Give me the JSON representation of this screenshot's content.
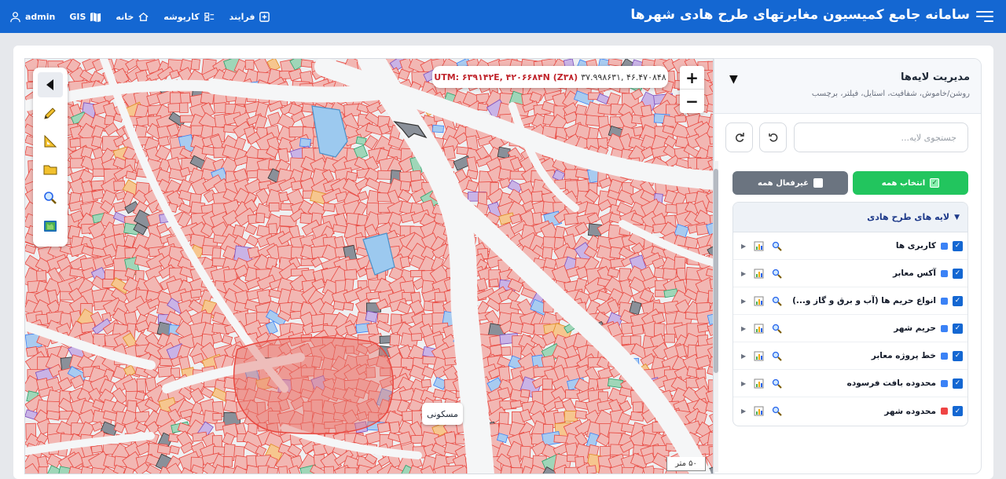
{
  "app": {
    "title": "سامانه جامع کمیسیون مغایرتهای طرح هادی شهرها"
  },
  "nav": {
    "items": [
      {
        "label": "فرایند",
        "icon": "plus-box-icon"
      },
      {
        "label": "کارپوشه",
        "icon": "folder-list-icon"
      },
      {
        "label": "خانه",
        "icon": "home-icon"
      },
      {
        "label": "GIS",
        "icon": "map-icon"
      },
      {
        "label": "admin",
        "icon": "user-icon"
      }
    ]
  },
  "map": {
    "coordinates": {
      "utm": "UTM: ۶۳۹۱۴۲E, ۴۲۰۶۶۸۴N (Z۳۸)",
      "latlng": "۳۷.۹۹۸۶۳۱, ۴۶.۴۷۰۸۴۸"
    },
    "zoom_in": "+",
    "zoom_out": "−",
    "place_label": "مسکونی",
    "scale_text": "۵۰ متر",
    "tools": [
      "pointer-icon",
      "pencil-icon",
      "ruler-triangle-icon",
      "folder-icon",
      "magnifier-icon",
      "book-map-icon"
    ],
    "colors": {
      "parcel_fill": "#f2b7b3",
      "parcel_stroke": "#e8473f",
      "road": "#f5f6f7",
      "background": "#eef0f2"
    }
  },
  "panel": {
    "title": "مدیریت لایه‌ها",
    "subtitle": "روشن/خاموش، شفافیت، استایل، فیلتر، برچسب",
    "search_placeholder": "جستجوی لایه...",
    "select_all": "انتخاب همه",
    "deselect_all": "غیرفعال همه",
    "group_title": "لایه های طرح هادی",
    "layers": [
      {
        "name": "کاربری ها",
        "color": "#3b82f6",
        "checked": true
      },
      {
        "name": "آکس معابر",
        "color": "#3b82f6",
        "checked": true
      },
      {
        "name": "انواع حریم ها (آب و برق و گاز و...)",
        "color": "#3b82f6",
        "checked": true
      },
      {
        "name": "حریم شهر",
        "color": "#3b82f6",
        "checked": true
      },
      {
        "name": "خط پروژه معابر",
        "color": "#3b82f6",
        "checked": true
      },
      {
        "name": "محدوده بافت فرسوده",
        "color": "#3b82f6",
        "checked": true
      },
      {
        "name": "محدوده شهر",
        "color": "#ef4444",
        "checked": true
      }
    ]
  }
}
